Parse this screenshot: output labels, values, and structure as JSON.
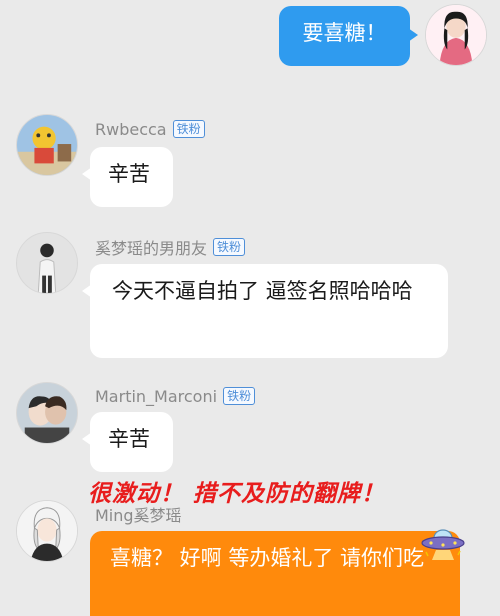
{
  "messages": [
    {
      "sender": "self",
      "text": "要喜糖！"
    },
    {
      "sender": "Rwbecca",
      "badge": "铁粉",
      "text": "辛苦"
    },
    {
      "sender": "奚梦瑶的男朋友",
      "badge": "铁粉",
      "text": "今天不逼自拍了 逼签名照哈哈哈"
    },
    {
      "sender": "Martin_Marconi",
      "badge": "铁粉",
      "text": "辛苦"
    },
    {
      "sender": "Ming奚梦瑶",
      "text": "喜糖？ 好啊 等办婚礼了 请你们吃"
    }
  ],
  "overlay_caption": "很激动！ 措不及防的翻牌！",
  "colors": {
    "background": "#eaeaea",
    "self_bubble": "#2f9bef",
    "reply_bubble": "#ff8a0c",
    "badge": "#4f8fd8",
    "caption": "#e81d1d"
  }
}
